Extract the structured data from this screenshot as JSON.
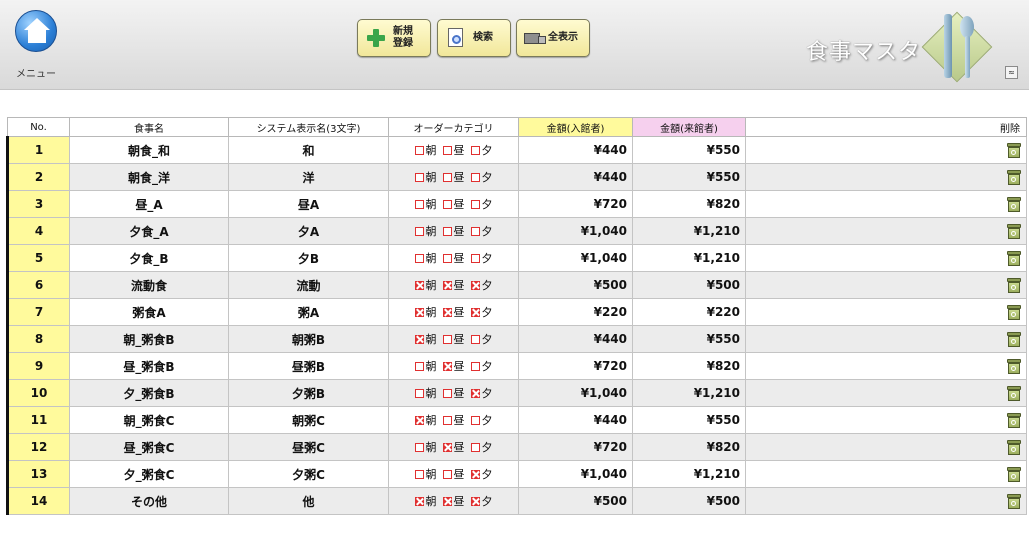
{
  "header": {
    "menu_label": "メニュー",
    "new_button": "新規\n登録",
    "search_button": "検索",
    "show_all_button": "全表示",
    "title": "食事マスタ",
    "collapse_symbol": "≈"
  },
  "table": {
    "columns": {
      "no": "No.",
      "name": "食事名",
      "short": "システム表示名(3文字)",
      "category": "オーダーカテゴリ",
      "amount_in": "金額(入館者)",
      "amount_out": "金額(来館者)",
      "delete": "削除"
    },
    "category_labels": [
      "朝",
      "昼",
      "夕"
    ],
    "colors": {
      "number_cell": "#fffa9c",
      "amount_in_header": "#fffa9c",
      "amount_out_header": "#f6d0ee",
      "checkbox": "#e03030"
    },
    "rows": [
      {
        "no": "1",
        "name": "朝食_和",
        "short": "和",
        "cats": [
          false,
          false,
          false
        ],
        "amount_in": "¥440",
        "amount_out": "¥550"
      },
      {
        "no": "2",
        "name": "朝食_洋",
        "short": "洋",
        "cats": [
          false,
          false,
          false
        ],
        "amount_in": "¥440",
        "amount_out": "¥550"
      },
      {
        "no": "3",
        "name": "昼_A",
        "short": "昼A",
        "cats": [
          false,
          false,
          false
        ],
        "amount_in": "¥720",
        "amount_out": "¥820"
      },
      {
        "no": "4",
        "name": "夕食_A",
        "short": "夕A",
        "cats": [
          false,
          false,
          false
        ],
        "amount_in": "¥1,040",
        "amount_out": "¥1,210"
      },
      {
        "no": "5",
        "name": "夕食_B",
        "short": "夕B",
        "cats": [
          false,
          false,
          false
        ],
        "amount_in": "¥1,040",
        "amount_out": "¥1,210"
      },
      {
        "no": "6",
        "name": "流動食",
        "short": "流動",
        "cats": [
          true,
          true,
          true
        ],
        "amount_in": "¥500",
        "amount_out": "¥500"
      },
      {
        "no": "7",
        "name": "粥食A",
        "short": "粥A",
        "cats": [
          true,
          true,
          true
        ],
        "amount_in": "¥220",
        "amount_out": "¥220"
      },
      {
        "no": "8",
        "name": "朝_粥食B",
        "short": "朝粥B",
        "cats": [
          true,
          false,
          false
        ],
        "amount_in": "¥440",
        "amount_out": "¥550"
      },
      {
        "no": "9",
        "name": "昼_粥食B",
        "short": "昼粥B",
        "cats": [
          false,
          true,
          false
        ],
        "amount_in": "¥720",
        "amount_out": "¥820"
      },
      {
        "no": "10",
        "name": "夕_粥食B",
        "short": "夕粥B",
        "cats": [
          false,
          false,
          true
        ],
        "amount_in": "¥1,040",
        "amount_out": "¥1,210"
      },
      {
        "no": "11",
        "name": "朝_粥食C",
        "short": "朝粥C",
        "cats": [
          true,
          false,
          false
        ],
        "amount_in": "¥440",
        "amount_out": "¥550"
      },
      {
        "no": "12",
        "name": "昼_粥食C",
        "short": "昼粥C",
        "cats": [
          false,
          true,
          false
        ],
        "amount_in": "¥720",
        "amount_out": "¥820"
      },
      {
        "no": "13",
        "name": "夕_粥食C",
        "short": "夕粥C",
        "cats": [
          false,
          false,
          true
        ],
        "amount_in": "¥1,040",
        "amount_out": "¥1,210"
      },
      {
        "no": "14",
        "name": "その他",
        "short": "他",
        "cats": [
          true,
          true,
          true
        ],
        "amount_in": "¥500",
        "amount_out": "¥500"
      }
    ]
  }
}
